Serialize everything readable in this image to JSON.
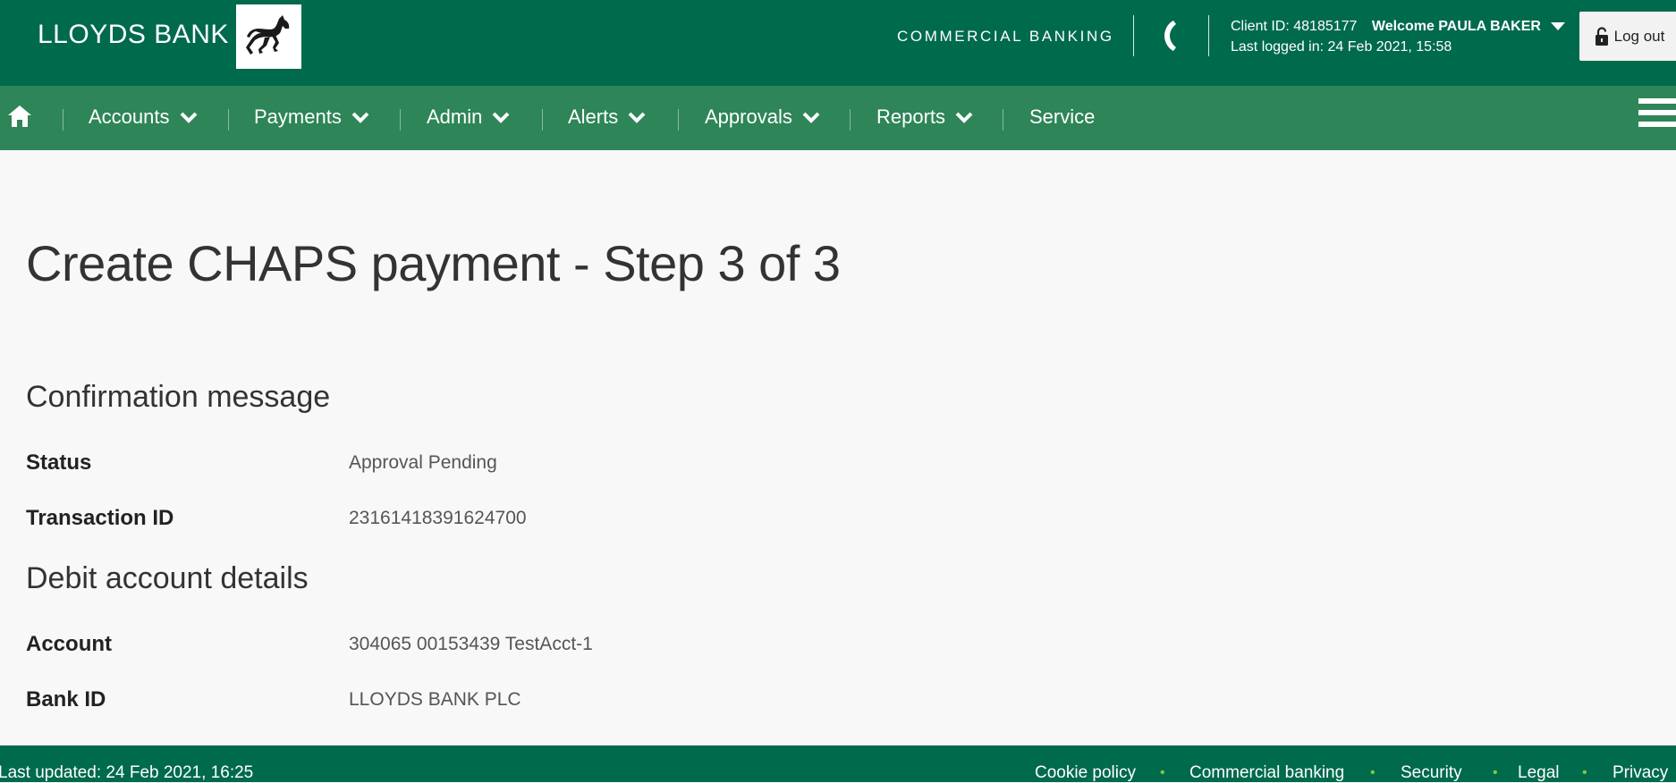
{
  "header": {
    "brand": "LLOYDS BANK",
    "section_label": "COMMERCIAL BANKING",
    "client_id": "Client ID: 48185177",
    "welcome": "Welcome PAULA BAKER",
    "last_logged_in": "Last logged in: 24 Feb 2021, 15:58",
    "logout_label": "Log out"
  },
  "nav": {
    "items": [
      {
        "label": "Accounts"
      },
      {
        "label": "Payments"
      },
      {
        "label": "Admin"
      },
      {
        "label": "Alerts"
      },
      {
        "label": "Approvals"
      },
      {
        "label": "Reports"
      },
      {
        "label": "Service"
      }
    ]
  },
  "main": {
    "page_title": "Create CHAPS payment - Step 3 of 3",
    "confirmation": {
      "heading": "Confirmation message",
      "status_label": "Status",
      "status_value": "Approval Pending",
      "transaction_label": "Transaction ID",
      "transaction_value": "23161418391624700"
    },
    "debit": {
      "heading": "Debit account details",
      "account_label": "Account",
      "account_value": "304065 00153439 TestAcct-1",
      "bank_label": "Bank ID",
      "bank_value": "LLOYDS BANK PLC"
    }
  },
  "footer": {
    "last_updated": "Last updated: 24 Feb 2021, 16:25",
    "links": [
      {
        "label": "Cookie policy"
      },
      {
        "label": "Commercial banking"
      },
      {
        "label": "Security"
      },
      {
        "label": "Legal"
      },
      {
        "label": "Privacy"
      }
    ]
  },
  "colors": {
    "header_green": "#006a4d",
    "nav_green": "#2e8558",
    "footer_dot": "#8ac43f",
    "page_background": "#f8f8f8"
  }
}
